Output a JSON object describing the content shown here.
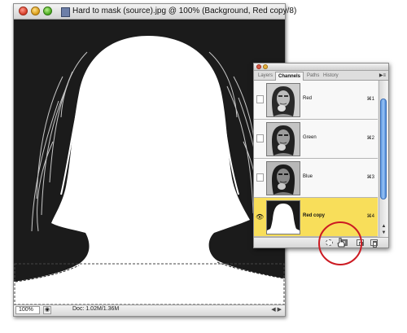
{
  "document": {
    "title": "Hard to mask (source).jpg @ 100% (Background, Red copy/8)",
    "status": {
      "zoom": "100%",
      "doc_size": "Doc: 1.02M/1.36M"
    }
  },
  "channels_palette": {
    "tabs": [
      {
        "label": "Layers",
        "active": false
      },
      {
        "label": "Channels",
        "active": true
      },
      {
        "label": "Paths",
        "active": false
      },
      {
        "label": "History",
        "active": false
      }
    ],
    "channels": [
      {
        "name": "Red",
        "shortcut": "⌘1",
        "selected": false,
        "visible": false
      },
      {
        "name": "Green",
        "shortcut": "⌘2",
        "selected": false,
        "visible": false
      },
      {
        "name": "Blue",
        "shortcut": "⌘3",
        "selected": false,
        "visible": false
      },
      {
        "name": "Red copy",
        "shortcut": "⌘4",
        "selected": true,
        "visible": true
      }
    ],
    "footer_buttons": [
      "load-channel-as-selection",
      "save-selection-as-channel",
      "create-new-channel",
      "delete-channel"
    ],
    "selected_color": "#f8de5a"
  },
  "annotation": {
    "circle_color": "#cc1a22",
    "target": "load-channel-as-selection"
  }
}
